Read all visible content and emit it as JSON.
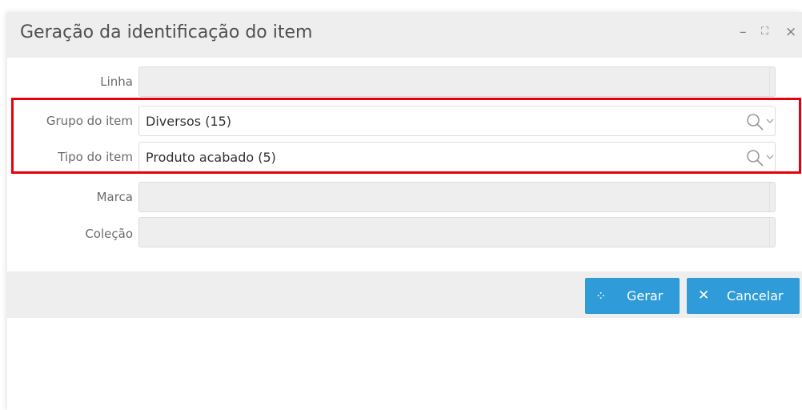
{
  "dialog": {
    "title": "Geração da identificação do item",
    "controls": {
      "minimize": "–",
      "maximize": "⛶",
      "close": "×"
    }
  },
  "form": {
    "linha": {
      "label": "Linha",
      "value": ""
    },
    "grupo": {
      "label": "Grupo do item",
      "value": "Diversos (15)"
    },
    "tipo": {
      "label": "Tipo do item",
      "value": "Produto acabado (5)"
    },
    "marca": {
      "label": "Marca",
      "value": ""
    },
    "colecao": {
      "label": "Coleção",
      "value": ""
    }
  },
  "icons": {
    "search": "search-icon",
    "chevron": "chevron-down-icon",
    "gerar": "spinner-icon",
    "cancelar": "close-icon"
  },
  "buttons": {
    "gerar": {
      "label": "Gerar",
      "icon_glyph": "⁘"
    },
    "cancelar": {
      "label": "Cancelar",
      "icon_glyph": "✕"
    }
  },
  "colors": {
    "primary_button": "#2f9bd9",
    "highlight_border": "#e8000b",
    "title_bar": "#eeeeee",
    "disabled_field": "#eeeeee"
  }
}
